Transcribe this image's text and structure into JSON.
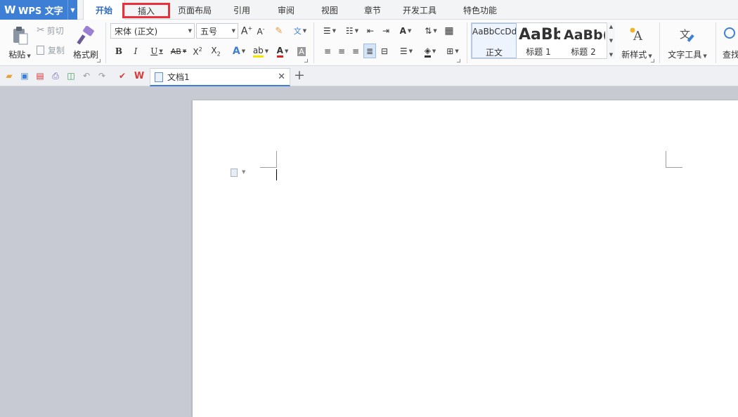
{
  "app": {
    "title": "WPS 文字"
  },
  "tabs": [
    "开始",
    "插入",
    "页面布局",
    "引用",
    "审阅",
    "视图",
    "章节",
    "开发工具",
    "特色功能"
  ],
  "ribbon": {
    "paste": "粘贴",
    "cut": "剪切",
    "copy": "复制",
    "format_painter": "格式刷",
    "font_name": "宋体 (正文)",
    "font_size": "五号",
    "styles": [
      {
        "sample": "AaBbCcDd",
        "name": "正文"
      },
      {
        "sample": "AaBb",
        "name": "标题 1"
      },
      {
        "sample": "AaBb(",
        "name": "标题 2"
      }
    ],
    "new_style": "新样式",
    "text_tools": "文字工具",
    "find": "查找"
  },
  "document": {
    "tab_name": "文档1"
  }
}
